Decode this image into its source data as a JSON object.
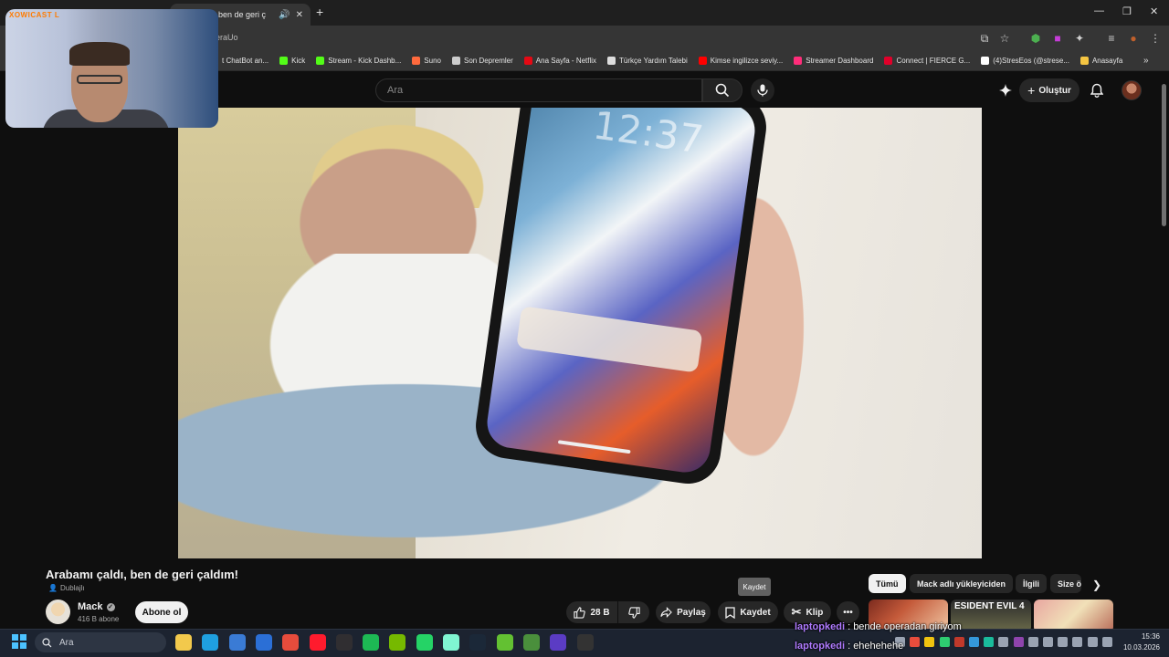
{
  "browser": {
    "tab_title": "ı çaldı, ben de geri ç",
    "url_fragment": "eraUo",
    "bookmarks": [
      {
        "label": "t ChatBot an...",
        "color": "#888888"
      },
      {
        "label": "Kick",
        "color": "#53fc18"
      },
      {
        "label": "Stream - Kick Dashb...",
        "color": "#53fc18"
      },
      {
        "label": "Suno",
        "color": "#ff6a3d"
      },
      {
        "label": "Son Depremler",
        "color": "#cccccc"
      },
      {
        "label": "Ana Sayfa - Netflix",
        "color": "#e50914"
      },
      {
        "label": "Türkçe Yardım Talebi",
        "color": "#dddddd"
      },
      {
        "label": "Kimse ingilizce seviy...",
        "color": "#ff0000"
      },
      {
        "label": "Streamer Dashboard",
        "color": "#ff2d7a"
      },
      {
        "label": "Connect | FIERCE G...",
        "color": "#e0002a"
      },
      {
        "label": "(4)StresEos (@strese...",
        "color": "#ffffff"
      },
      {
        "label": "Anasayfa",
        "color": "#f5c542"
      }
    ]
  },
  "overlay_brand": "XOWICAST L",
  "youtube": {
    "search_placeholder": "Ara",
    "create_label": "Oluştur"
  },
  "video": {
    "clock_text": "12:37",
    "title": "Arabamı çaldı, ben de geri çaldım!",
    "dubbed_label": "Dublajlı"
  },
  "channel": {
    "name": "Mack",
    "subs": "416 B abone",
    "subscribe_label": "Abone ol"
  },
  "actions": {
    "likes": "28 B",
    "share": "Paylaş",
    "save": "Kaydet",
    "clip": "Klip",
    "tooltip": "Kaydet"
  },
  "chips": [
    "Tümü",
    "Mack adlı yükleyiciden",
    "İlgili",
    "Size ö"
  ],
  "thumb_text": "ESIDENT EVIL 4",
  "chat": [
    {
      "user": "laptopkedi",
      "sep": " : ",
      "msg": "bende operadan giriyom"
    },
    {
      "user": "laptopkedi",
      "sep": " : ",
      "msg": "ehehehehe"
    }
  ],
  "taskbar": {
    "search_placeholder": "Ara",
    "time": "15:36",
    "date": "10.03.2026",
    "apps": [
      {
        "name": "file-explorer-icon",
        "color": "#f2c94c"
      },
      {
        "name": "edge-icon",
        "color": "#1fa0e0"
      },
      {
        "name": "store-icon",
        "color": "#3a7bd5"
      },
      {
        "name": "outlook-icon",
        "color": "#2b6fd6"
      },
      {
        "name": "chrome-icon",
        "color": "#e74c3c"
      },
      {
        "name": "opera-icon",
        "color": "#ff1b2d"
      },
      {
        "name": "obs-icon",
        "color": "#302e31"
      },
      {
        "name": "spotify-icon",
        "color": "#1db954"
      },
      {
        "name": "nvidia-icon",
        "color": "#76b900"
      },
      {
        "name": "whatsapp-icon",
        "color": "#25d366"
      },
      {
        "name": "streamlabs-icon",
        "color": "#80f5d2"
      },
      {
        "name": "steam-icon",
        "color": "#1b2838"
      },
      {
        "name": "alien-icon",
        "color": "#63c132"
      },
      {
        "name": "minecraft-icon",
        "color": "#4a8f3c"
      },
      {
        "name": "riot-icon",
        "color": "#5b3cc4"
      },
      {
        "name": "epic-icon",
        "color": "#333333"
      }
    ]
  }
}
